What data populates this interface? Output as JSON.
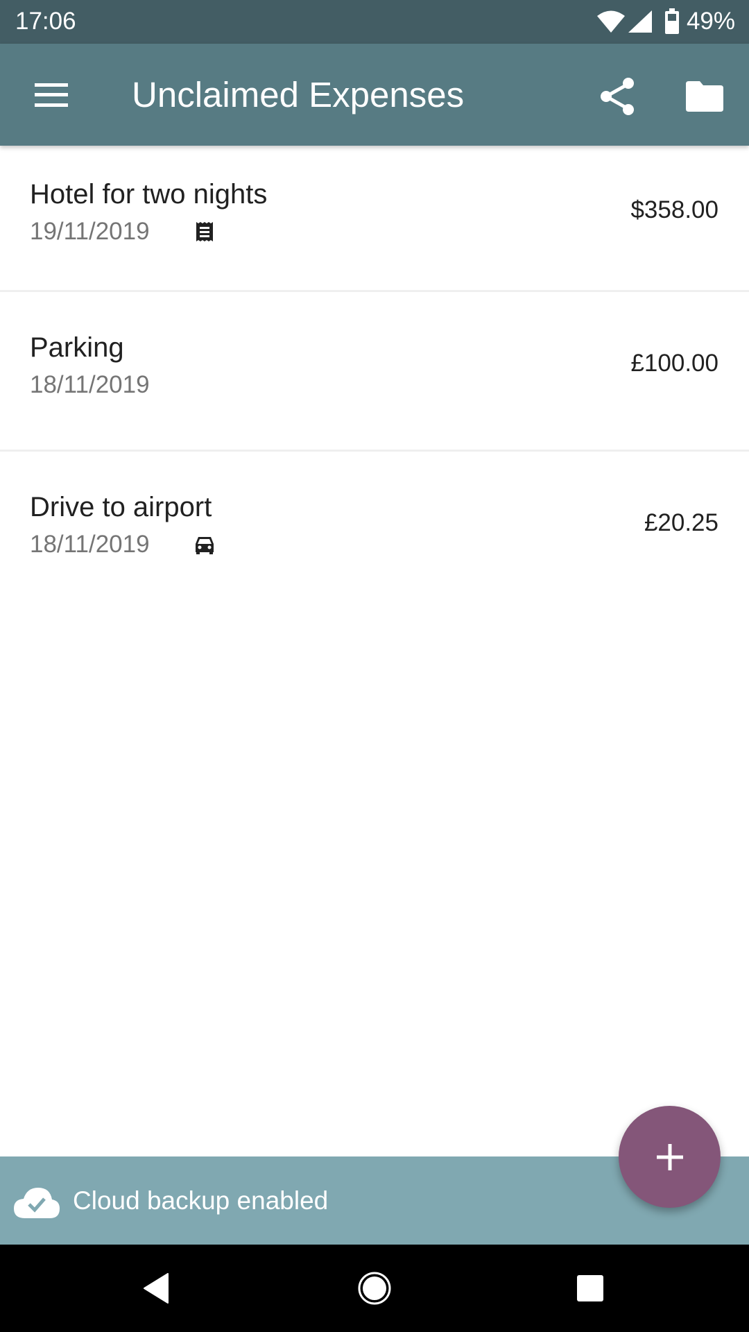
{
  "status_bar": {
    "time": "17:06",
    "battery_percent": "49%",
    "icons": [
      "wifi-icon",
      "cell-signal-icon",
      "battery-icon"
    ]
  },
  "app_bar": {
    "title": "Unclaimed Expenses",
    "menu_icon": "hamburger-menu-icon",
    "actions": [
      {
        "name": "share",
        "icon": "share-icon"
      },
      {
        "name": "folder",
        "icon": "folder-icon"
      }
    ]
  },
  "expenses": [
    {
      "title": "Hotel for two nights",
      "date": "19/11/2019",
      "amount": "$358.00",
      "icon": "receipt-icon"
    },
    {
      "title": "Parking",
      "date": "18/11/2019",
      "amount": "£100.00",
      "icon": null
    },
    {
      "title": "Drive to airport",
      "date": "18/11/2019",
      "amount": "£20.25",
      "icon": "car-icon"
    }
  ],
  "backup_banner": {
    "text": "Cloud backup enabled",
    "icon": "cloud-done-icon"
  },
  "fab": {
    "icon": "add-icon",
    "label": "+"
  },
  "nav_bar": {
    "buttons": [
      "back",
      "home",
      "recents"
    ]
  },
  "colors": {
    "status_bar": "#435d64",
    "app_bar": "#577b83",
    "banner": "#80a8b1",
    "fab": "#845679",
    "divider": "#efefef",
    "secondary_text": "#757575",
    "primary_text": "#212121"
  }
}
